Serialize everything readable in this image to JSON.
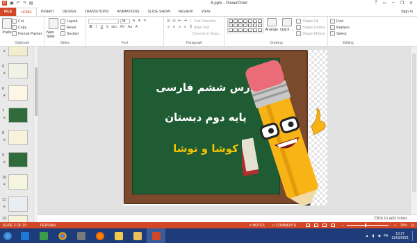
{
  "window": {
    "title": "6.pptx - PowerPoint",
    "controls": [
      "?",
      "▭",
      "–",
      "❐",
      "✕"
    ]
  },
  "quick_access": {
    "icons": [
      "save-icon",
      "undo-icon",
      "redo-icon",
      "start-presentation-icon"
    ]
  },
  "tabs": [
    {
      "label": "FILE"
    },
    {
      "label": "HOME"
    },
    {
      "label": "INSERT"
    },
    {
      "label": "DESIGN"
    },
    {
      "label": "TRANSITIONS"
    },
    {
      "label": "ANIMATIONS"
    },
    {
      "label": "SLIDE SHOW"
    },
    {
      "label": "REVIEW"
    },
    {
      "label": "VIEW"
    }
  ],
  "sign_in": "Sign in",
  "ribbon": {
    "clipboard": {
      "paste": "Paste",
      "cut": "Cut",
      "copy": "Copy",
      "format_painter": "Format Painter",
      "label": "Clipboard"
    },
    "slides": {
      "new_slide": "New Slide",
      "layout": "Layout",
      "reset": "Reset",
      "section": "Section",
      "label": "Slides"
    },
    "font": {
      "label": "Font",
      "size_value": "28",
      "buttons": [
        "B",
        "I",
        "U",
        "S",
        "abc",
        "AV",
        "Aa",
        "A"
      ]
    },
    "paragraph": {
      "label": "Paragraph",
      "text_direction": "Text Direction",
      "align_text": "Align Text",
      "convert_smartart": "Convert to SmartArt"
    },
    "drawing": {
      "label": "Drawing",
      "arrange": "Arrange",
      "quick_styles": "Quick Styles",
      "shape_fill": "Shape Fill",
      "shape_outline": "Shape Outline",
      "shape_effects": "Shape Effects"
    },
    "editing": {
      "label": "Editing",
      "find": "Find",
      "replace": "Replace",
      "select": "Select"
    }
  },
  "slide_thumbnails": [
    {
      "num": "4"
    },
    {
      "num": "5"
    },
    {
      "num": "6"
    },
    {
      "num": "7"
    },
    {
      "num": "8"
    },
    {
      "num": "9"
    },
    {
      "num": "10"
    },
    {
      "num": "11"
    },
    {
      "num": "12"
    }
  ],
  "slide": {
    "line1": "درس ششم فارسی",
    "line2": "پایه دوم دبستان",
    "line3": "کوشا و نوشا"
  },
  "notes_placeholder": "Click to add notes",
  "status": {
    "slide_of": "SLIDE 2 OF 19",
    "language": "PERSIAN",
    "notes_btn": "NOTES",
    "comments_btn": "COMMENTS",
    "zoom": "70%",
    "zoom_level_percent": 70
  },
  "taskbar": {
    "apps": [
      "internet-explorer-icon",
      "network-icon",
      "chrome-icon",
      "folder-icon",
      "firefox-icon",
      "file-explorer-icon",
      "windows-explorer-icon",
      "powerpoint-icon"
    ],
    "time": "13:27",
    "date": "11/03/2021",
    "lang": "FA"
  },
  "colors": {
    "accent": "#d24726",
    "board": "#1f5c33",
    "frame": "#7b4a2c",
    "title_yellow": "#f6c400",
    "taskbar": "#1d3c79"
  }
}
